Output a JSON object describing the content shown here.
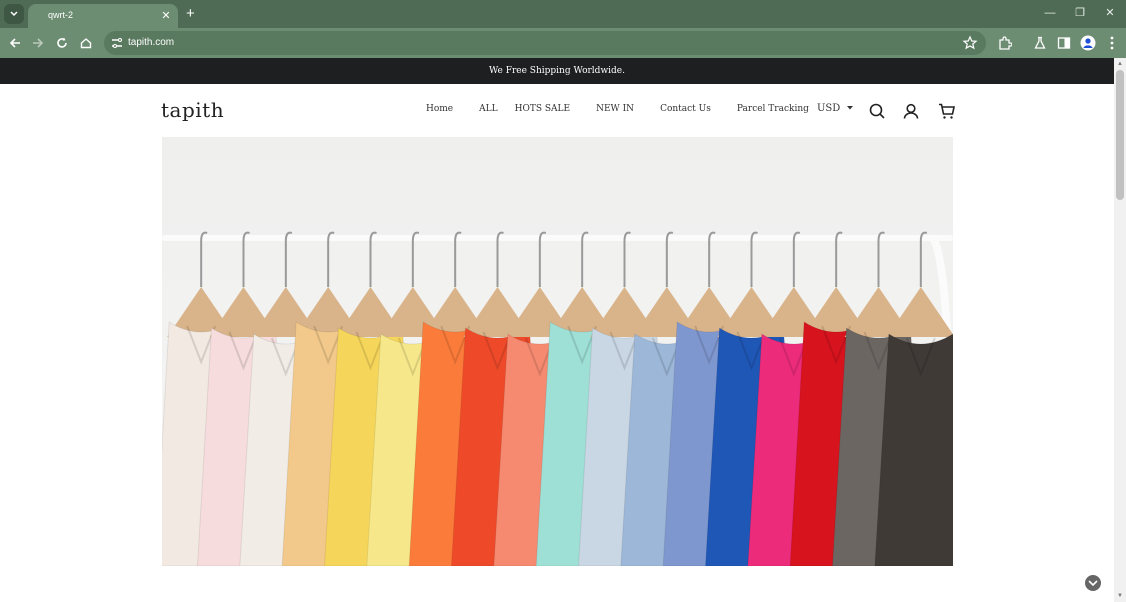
{
  "browser": {
    "tab_title": "qwrt-2",
    "url": "tapith.com"
  },
  "site": {
    "announcement": "We Free Shipping Worldwide.",
    "logo": "tapith",
    "nav": [
      "Home",
      "ALL",
      "HOTS SALE",
      "NEW IN",
      "Contact Us",
      "Parcel Tracking"
    ],
    "currency": "USD",
    "icons": [
      "search-icon",
      "account-icon",
      "cart-icon"
    ]
  },
  "hero": {
    "colors": [
      "#f3e9e3",
      "#f6dcdc",
      "#f1ece6",
      "#f2c98a",
      "#f6d65a",
      "#f6e88a",
      "#fb7b3a",
      "#ee4a2a",
      "#f58a70",
      "#9edfd6",
      "#c9d6e3",
      "#9cb7d8",
      "#7f97cf",
      "#1f57b6",
      "#ec2b7b",
      "#d7131e",
      "#6c6662",
      "#3f3a36"
    ]
  }
}
